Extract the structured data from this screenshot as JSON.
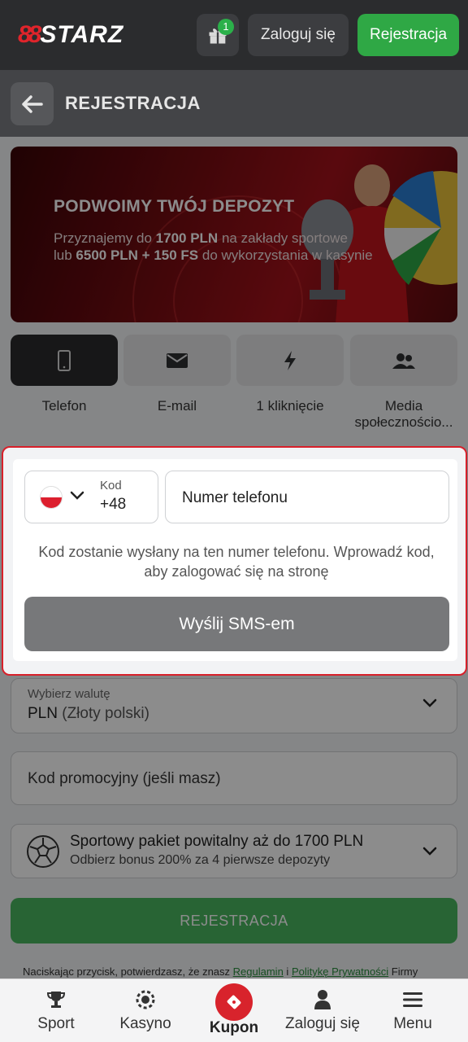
{
  "header": {
    "logo_mark": "88",
    "logo_name": "STARZ",
    "gift_badge": "1",
    "login_label": "Zaloguj się",
    "register_label": "Rejestracja"
  },
  "subheader": {
    "title": "REJESTRACJA"
  },
  "banner": {
    "title": "PODWOIMY TWÓJ DEPOZYT",
    "line1_prefix": "Przyznajemy do ",
    "line1_bold": "1700 PLN",
    "line1_suffix": " na zakłady sportowe",
    "line2_prefix": "lub ",
    "line2_bold": "6500 PLN + 150 FS",
    "line2_suffix": " do wykorzystania w kasynie"
  },
  "methods": [
    {
      "label": "Telefon",
      "icon": "phone-icon"
    },
    {
      "label": "E-mail",
      "icon": "envelope-icon"
    },
    {
      "label": "1 kliknięcie",
      "icon": "lightning-icon"
    },
    {
      "label": "Media społecznościo...",
      "icon": "users-icon"
    }
  ],
  "phone_form": {
    "code_caption": "Kod",
    "code_value": "+48",
    "phone_placeholder": "Numer telefonu",
    "hint": "Kod zostanie wysłany na ten numer telefonu. Wprowadź kod, aby zalogować się na stronę",
    "sms_button": "Wyślij SMS-em"
  },
  "currency": {
    "caption": "Wybierz walutę",
    "code": "PLN",
    "name": "(Złoty polski)"
  },
  "promo": {
    "placeholder": "Kod promocyjny (jeśli masz)"
  },
  "bonus": {
    "title": "Sportowy pakiet powitalny aż do 1700 PLN",
    "subtitle": "Odbierz bonus 200% za 4 pierwsze depozyty"
  },
  "submit_label": "REJESTRACJA",
  "consent": {
    "prefix": "Naciskając przycisk, potwierdzasz, że znasz ",
    "link1": "Regulamin",
    "middle": " i ",
    "link2": "Politykę Prywatności",
    "suffix": " Firmy"
  },
  "bottom_nav": {
    "sport": "Sport",
    "casino": "Kasyno",
    "kupon": "Kupon",
    "login": "Zaloguj się",
    "menu": "Menu"
  },
  "colors": {
    "accent_green": "#2fa845",
    "accent_red": "#d8232c",
    "header_bg": "#2b2c2e"
  }
}
